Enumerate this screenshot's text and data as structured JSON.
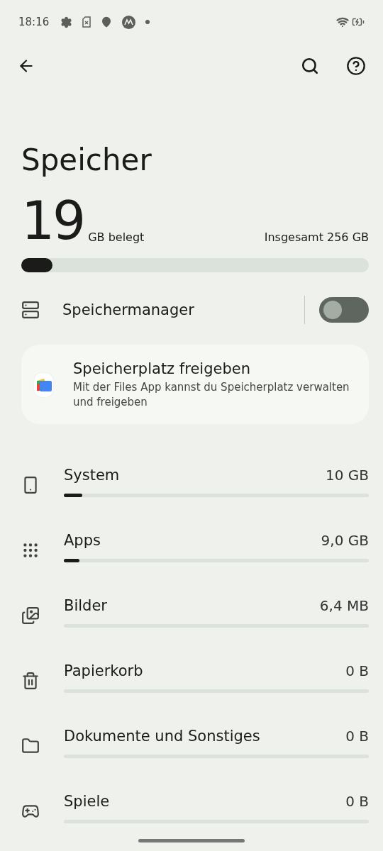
{
  "status_bar": {
    "time": "18:16"
  },
  "title": "Speicher",
  "usage": {
    "used": "19",
    "used_unit": "GB belegt",
    "total": "Insgesamt 256 GB",
    "level": 0.09
  },
  "storage_manager": {
    "label": "Speichermanager",
    "on": false
  },
  "files_card": {
    "title": "Speicherplatz freigeben",
    "description": "Mit der Files App kannst du Speicherplatz verwalten und freigeben"
  },
  "categories": [
    {
      "kind": "system",
      "label": "System",
      "size": "10 GB",
      "level": 0.06
    },
    {
      "kind": "apps",
      "label": "Apps",
      "size": "9,0 GB",
      "level": 0.05
    },
    {
      "kind": "images",
      "label": "Bilder",
      "size": "6,4 MB"
    },
    {
      "kind": "trash",
      "label": "Papierkorb",
      "size": "0 B"
    },
    {
      "kind": "documents",
      "label": "Dokumente und Sonstiges",
      "size": "0 B"
    },
    {
      "kind": "games",
      "label": "Spiele",
      "size": "0 B"
    }
  ]
}
